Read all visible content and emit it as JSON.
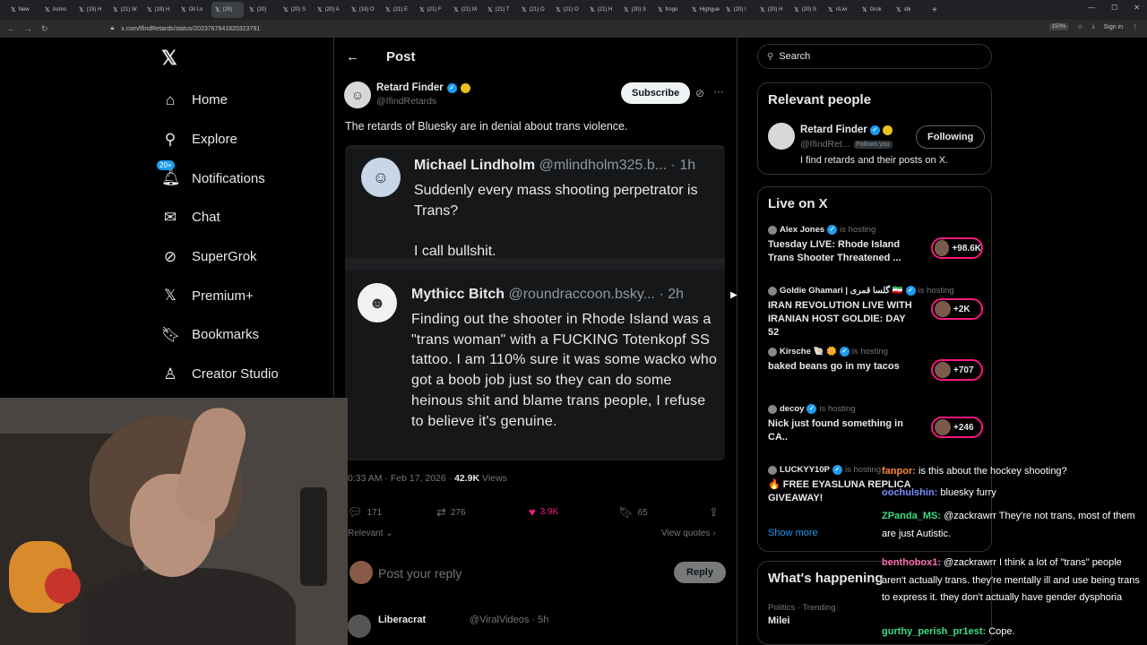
{
  "browser": {
    "tabs": [
      "New",
      "Asmo",
      "(19) H",
      "(21) W",
      "(19) H",
      "Oil Lo",
      "(20)",
      "(20)",
      "(20) S",
      "(20) A",
      "(19) O",
      "(21) E",
      "(21) F",
      "(21) M",
      "(21) T",
      "(21) O",
      "(21) O",
      "(21) H",
      "(20) S",
      "frogo",
      "Highgue",
      "(20) I",
      "(20) H",
      "(20) S",
      "r/Livi",
      "Grok",
      "sbi"
    ],
    "tab_plus": "+",
    "url": "x.com/IfindRetards/status/2023767641820323791",
    "zoom": "150%",
    "sign_in": "Sign in"
  },
  "left_nav": {
    "logo": "𝕏",
    "items": [
      {
        "label": "Home",
        "icon": "⌂"
      },
      {
        "label": "Explore",
        "icon": "⚲"
      },
      {
        "label": "Notifications",
        "icon": "🔔︎",
        "badge": "20+"
      },
      {
        "label": "Chat",
        "icon": "✉"
      },
      {
        "label": "SuperGrok",
        "icon": "⊘"
      },
      {
        "label": "Premium+",
        "icon": "𝕏"
      },
      {
        "label": "Bookmarks",
        "icon": "🔖︎"
      },
      {
        "label": "Creator Studio",
        "icon": "♙"
      }
    ]
  },
  "post": {
    "header_title": "Post",
    "author_name": "Retard Finder",
    "author_handle": "@IfindRetards",
    "subscribe_label": "Subscribe",
    "text": "The retards of Bluesky are in denial about trans violence.",
    "embeds": [
      {
        "name": "Michael Lindholm",
        "handle_time": "@mlindholm325.b... · 1h",
        "body": "Suddenly every mass shooting perpetrator is Trans?\n\nI call bullshit."
      },
      {
        "name": "Mythicc Bitch",
        "handle_time": "@roundraccoon.bsky... · 2h",
        "body": "Finding out the shooter in Rhode Island was a \"trans woman\" with a FUCKING Totenkopf SS tattoo. I am 110% sure it was some wacko who got a boob job just so they can do some heinous shit and blame trans people, I refuse to believe it's genuine."
      }
    ],
    "timestamp": "0:33 AM · Feb 17, 2026 · ",
    "views_count": "42.9K",
    "views_label": " Views",
    "replies": "171",
    "reposts": "276",
    "likes": "3.9K",
    "bookmarks": "65",
    "sort_label": "Relevant",
    "view_quotes": "View quotes",
    "reply_placeholder": "Post your reply",
    "reply_button": "Reply",
    "next_tweet_name": "Liberacrat",
    "next_tweet_handle": "@ViralVideos · 5h"
  },
  "right": {
    "search_placeholder": "Search",
    "relevant_title": "Relevant people",
    "rel_name": "Retard Finder",
    "rel_handle": "@IfindRet...",
    "follows_you": "Follows you",
    "following_label": "Following",
    "rel_bio": "I find retards and their posts on X.",
    "live_title": "Live on X",
    "live_items": [
      {
        "host": "Alex Jones",
        "hosting": "is hosting",
        "title": "Tuesday LIVE: Rhode Island Trans Shooter Threatened ...",
        "count": "+98.6K"
      },
      {
        "host": "Goldie Ghamari | گلسا قمری 🇮🇷",
        "hosting": "is hosting",
        "title": "IRAN REVOLUTION LIVE WITH IRANIAN HOST GOLDIE: DAY 52",
        "count": "+2K"
      },
      {
        "host": "Kirsche 🐚 🌼",
        "hosting": "is hosting",
        "title": "baked beans go in my tacos",
        "count": "+707"
      },
      {
        "host": "decoy",
        "hosting": "is hosting",
        "title": "Nick just found something in CA..",
        "count": "+246"
      },
      {
        "host": "LUCKYY10P",
        "hosting": "is hosting",
        "title": "🔥 FREE EYASLUNA REPLICA GIVEAWAY!",
        "count": ""
      }
    ],
    "show_more": "Show more",
    "happening_title": "What's happening",
    "happening_meta": "Politics · Trending",
    "happening_topic": "Milei"
  },
  "chat": [
    {
      "user": "fanpor:",
      "text": " is this about the hockey shooting?",
      "color": "#ff8a3d"
    },
    {
      "user": "oochulshin:",
      "text": " bluesky furry",
      "color": "#7a8cff"
    },
    {
      "user": "ZPanda_MS:",
      "text": " @zackrawrr They're not trans, most of them are just Autistic.",
      "color": "#3ddc84"
    },
    {
      "user": "benthobox1:",
      "text": " @zackrawrr I think a lot of \"trans\" people aren't actually trans. they're mentally ill and use being trans to express it. they don't actually have gender dysphoria",
      "color": "#ff6fb5"
    },
    {
      "user": "gurthy_perish_pr1est:",
      "text": " Cope.",
      "color": "#3ddc84"
    }
  ]
}
